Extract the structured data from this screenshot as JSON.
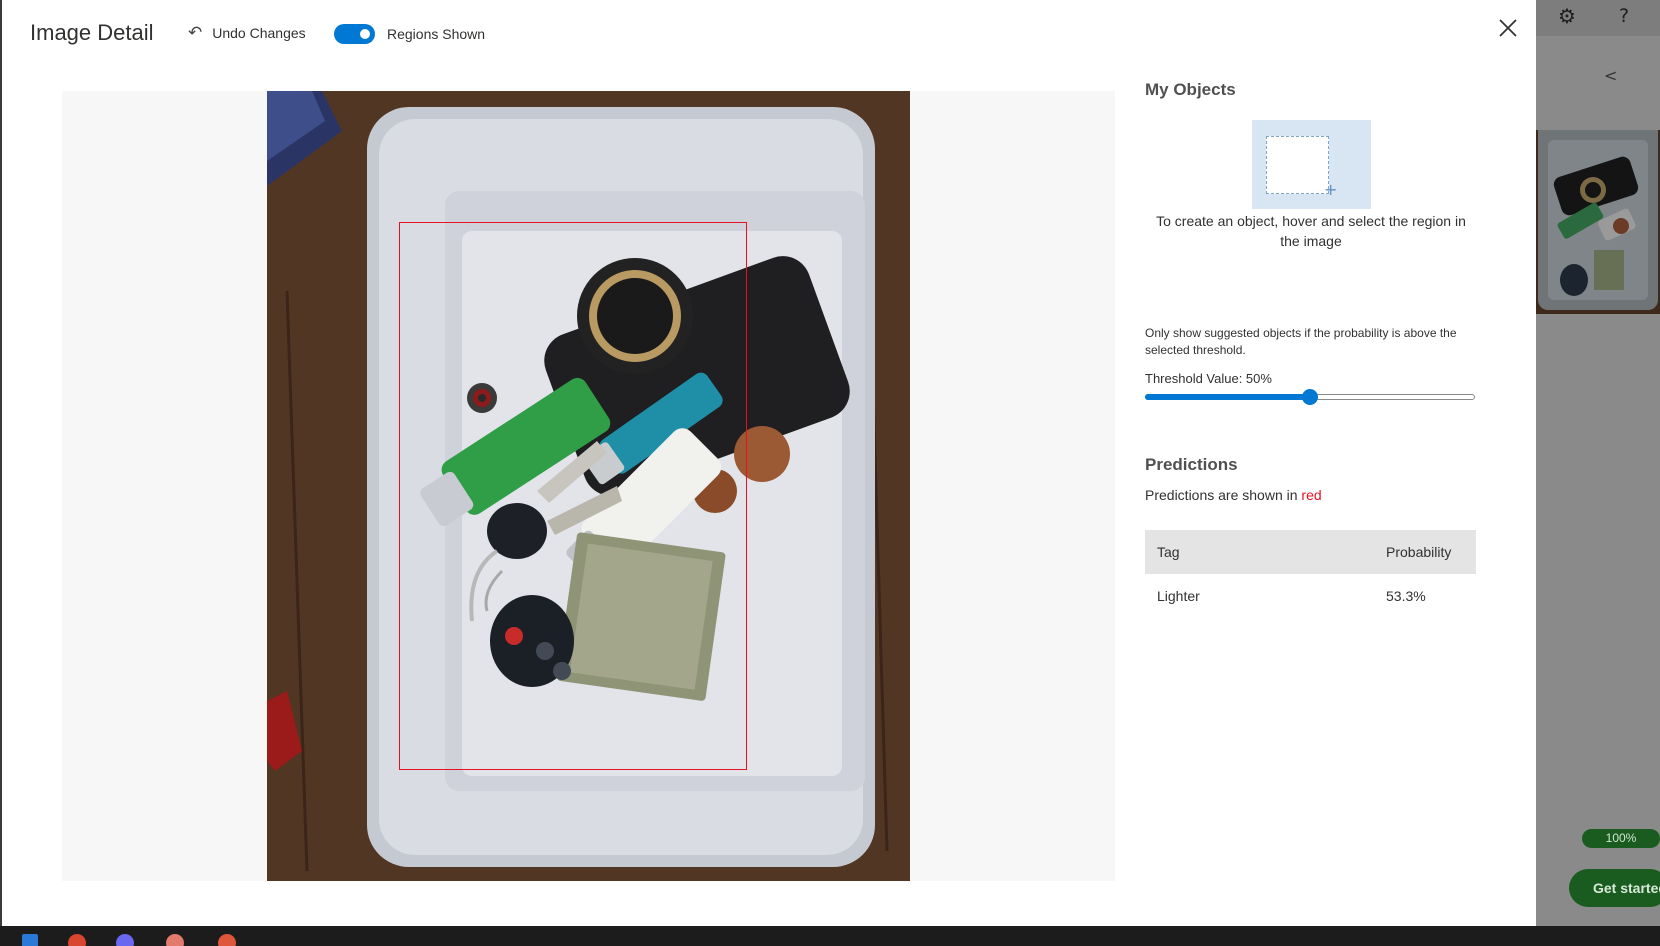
{
  "modal": {
    "title": "Image Detail",
    "undo_label": "Undo Changes",
    "regions_toggle_label": "Regions Shown",
    "regions_toggle_on": true
  },
  "objects": {
    "heading": "My Objects",
    "help_text": "To create an object, hover and select the region in the image"
  },
  "threshold": {
    "note": "Only show suggested objects if the probability is above the selected threshold.",
    "label": "Threshold Value: 50%",
    "value_percent": 50
  },
  "predictions": {
    "heading": "Predictions",
    "note_prefix": "Predictions are shown in ",
    "note_color_word": "red",
    "columns": [
      "Tag",
      "Probability"
    ],
    "rows": [
      {
        "tag": "Lighter",
        "probability": "53.3%"
      }
    ]
  },
  "background_app": {
    "progress_label": "100%",
    "get_started_label": "Get started",
    "collapse_glyph": "<"
  },
  "colors": {
    "accent": "#0078d4",
    "region": "#e81123",
    "progress_green": "#1a5b20"
  }
}
